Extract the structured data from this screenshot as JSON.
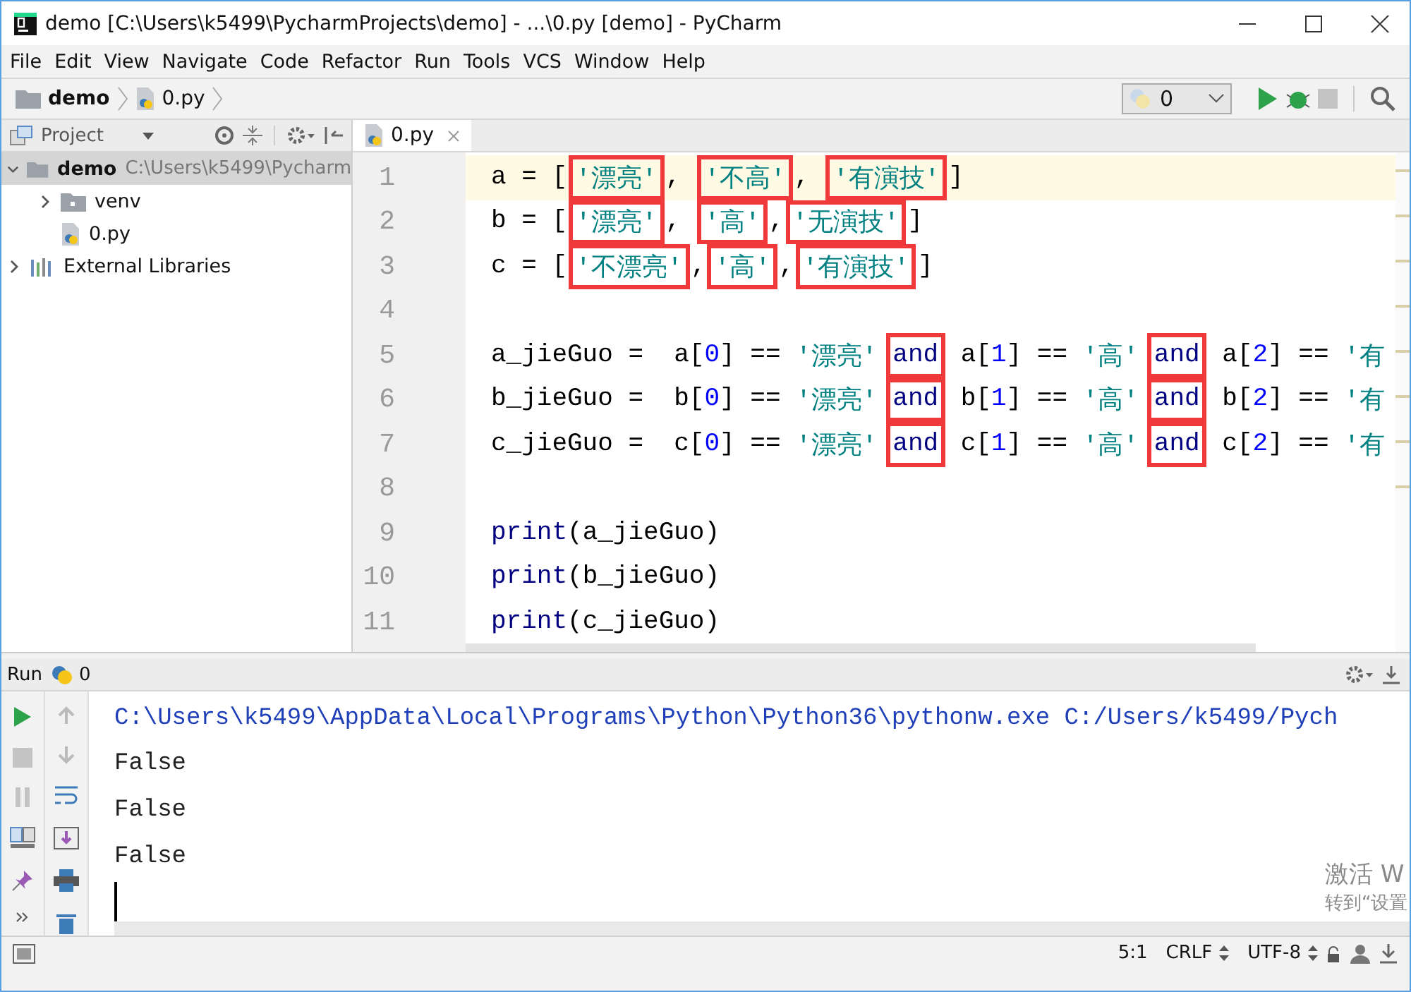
{
  "window": {
    "title": "demo [C:\\Users\\k5499\\PycharmProjects\\demo] - ...\\0.py [demo] - PyCharm"
  },
  "menu": [
    {
      "label": "File"
    },
    {
      "label": "Edit"
    },
    {
      "label": "View"
    },
    {
      "label": "Navigate"
    },
    {
      "label": "Code"
    },
    {
      "label": "Refactor"
    },
    {
      "label": "Run"
    },
    {
      "label": "Tools"
    },
    {
      "label": "VCS"
    },
    {
      "label": "Window"
    },
    {
      "label": "Help"
    }
  ],
  "breadcrumbs": [
    {
      "label": "demo",
      "kind": "folder"
    },
    {
      "label": "0.py",
      "kind": "python"
    }
  ],
  "run_config": {
    "label": "0"
  },
  "project_panel": {
    "title": "Project",
    "tree": [
      {
        "label": "demo",
        "path": "C:\\Users\\k5499\\Pycharm",
        "kind": "folder",
        "expanded": true,
        "selected": true,
        "children": [
          {
            "label": "venv",
            "kind": "folder",
            "expanded": false,
            "selected": false
          },
          {
            "label": "0.py",
            "kind": "python",
            "selected": false
          }
        ]
      },
      {
        "label": "External Libraries",
        "kind": "library",
        "expanded": false,
        "selected": false
      }
    ]
  },
  "editor": {
    "tabs": [
      {
        "label": "0.py",
        "selected": true
      }
    ],
    "lines": [
      {
        "number": "1",
        "current": true,
        "tokens": [
          {
            "kind": "plain",
            "text": "a = ["
          },
          {
            "kind": "str",
            "text": "'漂亮'",
            "boxed": true
          },
          {
            "kind": "plain",
            "text": ", "
          },
          {
            "kind": "str",
            "text": "'不高'",
            "boxed": true
          },
          {
            "kind": "plain",
            "text": ", "
          },
          {
            "kind": "str",
            "text": "'有演技'",
            "boxed": true
          },
          {
            "kind": "plain",
            "text": "]"
          }
        ]
      },
      {
        "number": "2",
        "current": false,
        "tokens": [
          {
            "kind": "plain",
            "text": "b = ["
          },
          {
            "kind": "str",
            "text": "'漂亮'",
            "boxed": true
          },
          {
            "kind": "plain",
            "text": ", "
          },
          {
            "kind": "str",
            "text": "'高'",
            "boxed": true
          },
          {
            "kind": "plain",
            "text": ","
          },
          {
            "kind": "str",
            "text": "'无演技'",
            "boxed": true
          },
          {
            "kind": "plain",
            "text": "]"
          }
        ]
      },
      {
        "number": "3",
        "current": false,
        "tokens": [
          {
            "kind": "plain",
            "text": "c = ["
          },
          {
            "kind": "str",
            "text": "'不漂亮'",
            "boxed": true
          },
          {
            "kind": "plain",
            "text": ","
          },
          {
            "kind": "str",
            "text": "'高'",
            "boxed": true
          },
          {
            "kind": "plain",
            "text": ","
          },
          {
            "kind": "str",
            "text": "'有演技'",
            "boxed": true
          },
          {
            "kind": "plain",
            "text": "]"
          }
        ]
      },
      {
        "number": "4",
        "current": false
      },
      {
        "number": "5",
        "current": false,
        "tokens": [
          {
            "kind": "plain",
            "text": "a_jieGuo =  a["
          },
          {
            "kind": "num",
            "text": "0"
          },
          {
            "kind": "plain",
            "text": "] == "
          },
          {
            "kind": "str",
            "text": "'漂亮'"
          },
          {
            "kind": "kw",
            "text": "and",
            "boxed": true
          },
          {
            "kind": "plain",
            "text": " a["
          },
          {
            "kind": "num",
            "text": "1"
          },
          {
            "kind": "plain",
            "text": "] == "
          },
          {
            "kind": "str",
            "text": "'高'"
          },
          {
            "kind": "kw",
            "text": "and",
            "boxed": true
          },
          {
            "kind": "plain",
            "text": " a["
          },
          {
            "kind": "num",
            "text": "2"
          },
          {
            "kind": "plain",
            "text": "] == "
          },
          {
            "kind": "str",
            "text": "'有"
          }
        ]
      },
      {
        "number": "6",
        "current": false,
        "tokens": [
          {
            "kind": "plain",
            "text": "b_jieGuo =  b["
          },
          {
            "kind": "num",
            "text": "0"
          },
          {
            "kind": "plain",
            "text": "] == "
          },
          {
            "kind": "str",
            "text": "'漂亮'"
          },
          {
            "kind": "kw",
            "text": "and",
            "boxed": true
          },
          {
            "kind": "plain",
            "text": " b["
          },
          {
            "kind": "num",
            "text": "1"
          },
          {
            "kind": "plain",
            "text": "] == "
          },
          {
            "kind": "str",
            "text": "'高'"
          },
          {
            "kind": "kw",
            "text": "and",
            "boxed": true
          },
          {
            "kind": "plain",
            "text": " b["
          },
          {
            "kind": "num",
            "text": "2"
          },
          {
            "kind": "plain",
            "text": "] == "
          },
          {
            "kind": "str",
            "text": "'有"
          }
        ]
      },
      {
        "number": "7",
        "current": false,
        "tokens": [
          {
            "kind": "plain",
            "text": "c_jieGuo =  c["
          },
          {
            "kind": "num",
            "text": "0"
          },
          {
            "kind": "plain",
            "text": "] == "
          },
          {
            "kind": "str",
            "text": "'漂亮'"
          },
          {
            "kind": "kw",
            "text": "and",
            "boxed": true
          },
          {
            "kind": "plain",
            "text": " c["
          },
          {
            "kind": "num",
            "text": "1"
          },
          {
            "kind": "plain",
            "text": "] == "
          },
          {
            "kind": "str",
            "text": "'高'"
          },
          {
            "kind": "kw",
            "text": "and",
            "boxed": true
          },
          {
            "kind": "plain",
            "text": " c["
          },
          {
            "kind": "num",
            "text": "2"
          },
          {
            "kind": "plain",
            "text": "] == "
          },
          {
            "kind": "str",
            "text": "'有"
          }
        ]
      },
      {
        "number": "8",
        "current": false
      },
      {
        "number": "9",
        "current": false,
        "tokens": [
          {
            "kind": "fn",
            "text": "print"
          },
          {
            "kind": "plain",
            "text": "(a_jieGuo)"
          }
        ]
      },
      {
        "number": "10",
        "current": false,
        "tokens": [
          {
            "kind": "fn",
            "text": "print"
          },
          {
            "kind": "plain",
            "text": "(b_jieGuo)"
          }
        ]
      },
      {
        "number": "11",
        "current": false,
        "tokens": [
          {
            "kind": "fn",
            "text": "print"
          },
          {
            "kind": "plain",
            "text": "(c_jieGuo)"
          }
        ]
      }
    ]
  },
  "run_panel": {
    "title": "Run",
    "config": "0",
    "output": [
      {
        "kind": "command",
        "text": "C:\\Users\\k5499\\AppData\\Local\\Programs\\Python\\Python36\\pythonw.exe C:/Users/k5499/Pych"
      },
      {
        "kind": "plain",
        "text": "False"
      },
      {
        "kind": "plain",
        "text": "False"
      },
      {
        "kind": "plain",
        "text": "False"
      }
    ]
  },
  "activation_notice": [
    "激活 W",
    "转到“设置"
  ],
  "status_bar": {
    "position": "5:1",
    "line_separator": "CRLF",
    "encoding": "UTF-8"
  }
}
